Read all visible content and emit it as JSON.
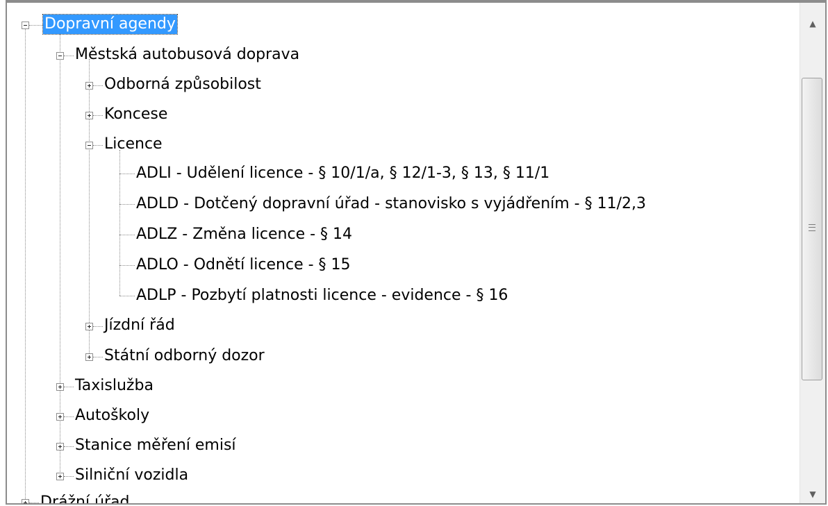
{
  "tree": {
    "root": {
      "label": "Dopravní agendy"
    },
    "mestska": {
      "label": "Městská autobusová doprava"
    },
    "odborna": {
      "label": "Odborná způsobilost"
    },
    "koncese": {
      "label": "Koncese"
    },
    "licence": {
      "label": "Licence"
    },
    "adli": {
      "label": "ADLI - Udělení licence - § 10/1/a, § 12/1-3, § 13, § 11/1"
    },
    "adld": {
      "label": "ADLD - Dotčený dopravní úřad - stanovisko s vyjádřením - § 11/2,3"
    },
    "adlz": {
      "label": "ADLZ - Změna licence - § 14"
    },
    "adlo": {
      "label": "ADLO - Odnětí licence - § 15"
    },
    "adlp": {
      "label": "ADLP - Pozbytí platnosti licence - evidence - § 16"
    },
    "jizdni": {
      "label": "Jízdní řád"
    },
    "statni": {
      "label": "Státní odborný dozor"
    },
    "taxi": {
      "label": "Taxislužba"
    },
    "autoskoly": {
      "label": "Autoškoly"
    },
    "stanice": {
      "label": "Stanice měření emisí"
    },
    "silnicni": {
      "label": "Silniční vozidla"
    },
    "drazni": {
      "label": "Drážní úřad"
    }
  },
  "scrollbar": {
    "up_icon": "scroll-up-arrow",
    "down_icon": "scroll-down-arrow",
    "grip_icon": "grip-lines"
  },
  "colors": {
    "selection": "#3399ff",
    "border": "#8c8c8c"
  }
}
